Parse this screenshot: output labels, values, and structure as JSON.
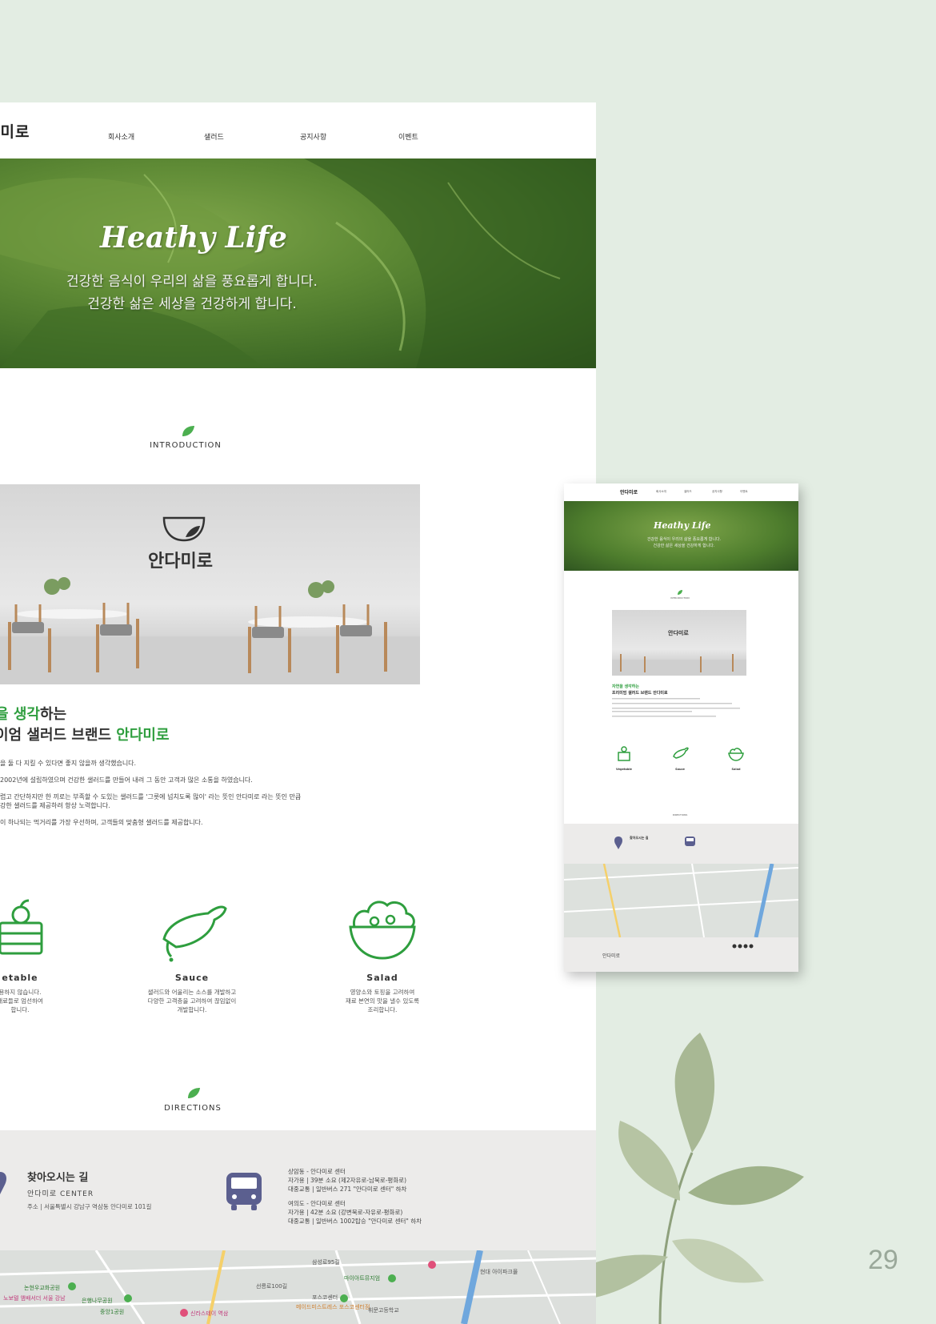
{
  "page_number": "29",
  "nav": {
    "logo": "다미로",
    "menu": [
      "회사소개",
      "샐러드",
      "공지사항",
      "이벤트"
    ]
  },
  "hero": {
    "title": "Heathy Life",
    "line1": "건강한 음식이 우리의 삶을 풍요롭게 합니다.",
    "line2": "건강한 삶은 세상을 건강하게 합니다."
  },
  "intro": {
    "label": "INTRODUCTION",
    "cafe_logo": "안다미로",
    "head1_green": "을 생각",
    "head1_rest": "하는",
    "head2_rest": "이엄 샐러드 브랜드 ",
    "head2_green": "안다미로",
    "p1": "을 둘 다 지킬 수 있다면 좋지 않을까 생각했습니다.",
    "p2": "2002년에 설립하였으며 건강한 샐러드를 만들어 내려 그 동안 고객과 많은 소통을 하였습니다.",
    "p3a": "렵고 간단하지만 한 끼로는 부족할 수 도있는 샐러드를 '그릇에 넘치도록 많이' 라는 뜻인 안다미로 라는 뜻인 만큼",
    "p3b": "강한 샐러드를 제공하려 항상 노력합니다.",
    "p4": "이 하나되는 먹거리를 가장 우선하며, 고객들의 맞춤형 샐러드를 제공합니다."
  },
  "features": [
    {
      "name": "etable",
      "desc": [
        "용하지 않습니다.",
        "재료들로 엄선하여",
        "합니다."
      ]
    },
    {
      "name": "Sauce",
      "desc": [
        "샐러드와 어울리는 소스를 개발하고",
        "다양한 고객층을 고려하여 끊임없이",
        "개발합니다."
      ]
    },
    {
      "name": "Salad",
      "desc": [
        "영양소와 토핑을 고려하여",
        "재료 본연의 맛을 낼수 있도록",
        "조리합니다."
      ]
    }
  ],
  "directions": {
    "label": "DIRECTIONS",
    "title": "찾아오시는 길",
    "center": "안다미로 CENTER",
    "address": "주소 | 서울특별시 강남구 역삼동 안다미로 101길",
    "route1": [
      "상암동 - 안다미로 센터",
      "자가용 | 39분 소요 (제2자유로-남북로-평화로)",
      "대중교통 | 일반버스 271 \"안다미로 센터\" 하차"
    ],
    "route2": [
      "여의도 - 안다미로 센터",
      "자가용 | 42분 소요 (강변북로-자유로-평화로)",
      "대중교통 | 일반버스 1002탑승 \"안다미로 센터\" 하차"
    ]
  },
  "map_labels": [
    "논현우교화공원",
    "은행나무공원",
    "노보텔 앰배서더 서울 강남",
    "중앙1공원",
    "신라스테이 역삼",
    "마이아트뮤지엄",
    "포스코센터",
    "메이드미스트레스 포스코센터점",
    "휘문고등학교",
    "현대 아이파크몰",
    "선릉로100길",
    "삼성로95길"
  ],
  "small": {
    "logo": "안다미로",
    "menu": [
      "회사소개",
      "샐러드",
      "공지사항",
      "이벤트"
    ],
    "title": "Heathy Life",
    "sub1": "건강한 음식이 우리의 삶을 풍요롭게 합니다.",
    "sub2": "건강한 삶은 세상을 건강하게 합니다.",
    "intro_label": "INTRODUCTION",
    "cafe_logo": "안다미로",
    "head1": "자연을 생각하는",
    "head2": "프리미엄 샐러드 브랜드 안다미로",
    "features": [
      "Vegetable",
      "Sauce",
      "Salad"
    ],
    "dir_label": "DIRECTIONS",
    "dir_title": "찾아오시는 길",
    "foot_logo": "안다미로"
  },
  "colors": {
    "accent_green": "#2e9e3e",
    "bus_purple": "#5b5f8f",
    "bg": "#e3ede3"
  }
}
